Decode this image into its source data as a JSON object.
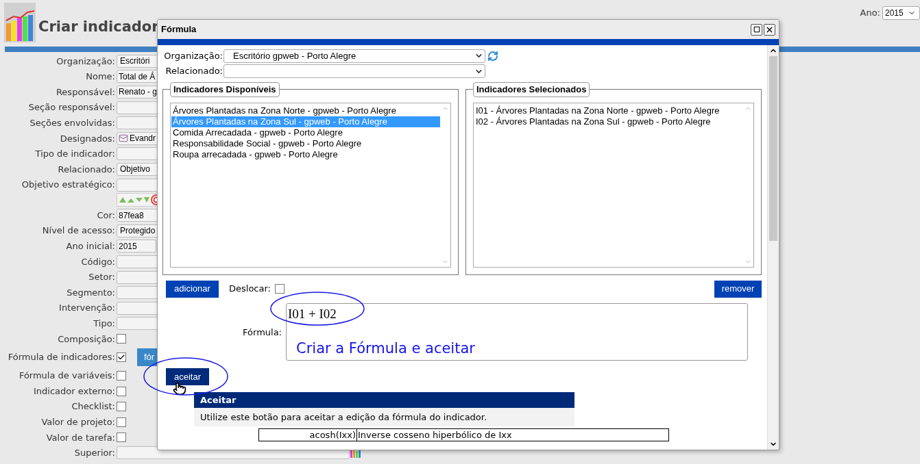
{
  "page": {
    "title": "Criar indicador",
    "year_label": "Ano:",
    "year": "2015"
  },
  "form": [
    {
      "kind": "select",
      "label": "Organização:",
      "value": "Escritóri"
    },
    {
      "kind": "text",
      "label": "Nome:",
      "value": "Total de Á"
    },
    {
      "kind": "text",
      "label": "Responsável:",
      "value": "Renato - g"
    },
    {
      "kind": "text",
      "label": "Seção responsável:"
    },
    {
      "kind": "text",
      "label": "Seções envolvidas:"
    },
    {
      "kind": "assignees",
      "label": "Designados:",
      "value": "Evandr"
    },
    {
      "kind": "text",
      "label": "Tipo de indicador:"
    },
    {
      "kind": "select",
      "label": "Relacionado:",
      "value": "Objetivo"
    },
    {
      "kind": "text",
      "label": "Objetivo estratégico:"
    },
    {
      "kind": "toolbar"
    },
    {
      "kind": "text",
      "label": "Cor:",
      "value": "87fea8"
    },
    {
      "kind": "select",
      "label": "Nível de acesso:",
      "value": "Protegido"
    },
    {
      "kind": "short",
      "label": "Ano inicial:",
      "value": "2015"
    },
    {
      "kind": "text",
      "label": "Código:"
    },
    {
      "kind": "text",
      "label": "Setor:"
    },
    {
      "kind": "text",
      "label": "Segmento:"
    },
    {
      "kind": "text",
      "label": "Intervenção:"
    },
    {
      "kind": "text",
      "label": "Tipo:"
    },
    {
      "kind": "checkbox",
      "label": "Composição:",
      "checked": false
    },
    {
      "kind": "checkbox_button",
      "label": "Fórmula de indicadores:",
      "checked": true,
      "button": "fór"
    },
    {
      "kind": "checkbox",
      "label": "Fórmula de variáveis:",
      "checked": false
    },
    {
      "kind": "checkbox",
      "label": "Indicador externo:",
      "checked": false
    },
    {
      "kind": "checkbox",
      "label": "Checklist:",
      "checked": false
    },
    {
      "kind": "checkbox",
      "label": "Valor de projeto:",
      "checked": false
    },
    {
      "kind": "checkbox",
      "label": "Valor de tarefa:",
      "checked": false
    },
    {
      "kind": "wide",
      "label": "Superior:"
    }
  ],
  "dialog": {
    "title": "Fórmula",
    "organization": {
      "label": "Organização:",
      "value": "Escritório gpweb - Porto Alegre"
    },
    "related": {
      "label": "Relacionado:"
    },
    "available": {
      "title": "Indicadores Disponíveis",
      "items": [
        {
          "label": "Árvores Plantadas na Zona Norte - gpweb - Porto Alegre",
          "selected": false
        },
        {
          "label": "Árvores Plantadas na Zona Sul - gpweb - Porto Alegre",
          "selected": true
        },
        {
          "label": "Comida Arrecadada - gpweb - Porto Alegre",
          "selected": false
        },
        {
          "label": "Responsabilidade Social - gpweb - Porto Alegre",
          "selected": false
        },
        {
          "label": "Roupa arrecadada - gpweb - Porto Alegre",
          "selected": false
        }
      ]
    },
    "chosen": {
      "title": "Indicadores Selecionados",
      "items": [
        {
          "label": "I01 - Árvores Plantadas na Zona Norte - gpweb - Porto Alegre",
          "selected": false
        },
        {
          "label": "I02 - Árvores Plantadas na Zona Sul - gpweb - Porto Alegre",
          "selected": false
        }
      ]
    },
    "add_button": "adicionar",
    "shift": {
      "label": "Deslocar:",
      "checked": false
    },
    "remove_button": "remover",
    "formula": {
      "label": "Fórmula:",
      "value": "I01 + I02"
    },
    "accept_button": "aceitar",
    "tooltip": {
      "title": "Aceitar",
      "text": "Utilize este botão para aceitar a edição da fórmula do indicador."
    },
    "functions": [
      {
        "name": "acosh(Ixx)",
        "description": "Inverse cosseno hiperbólico de Ixx"
      }
    ]
  },
  "annotation": {
    "text": "Criar a Fórmula e aceitar"
  }
}
